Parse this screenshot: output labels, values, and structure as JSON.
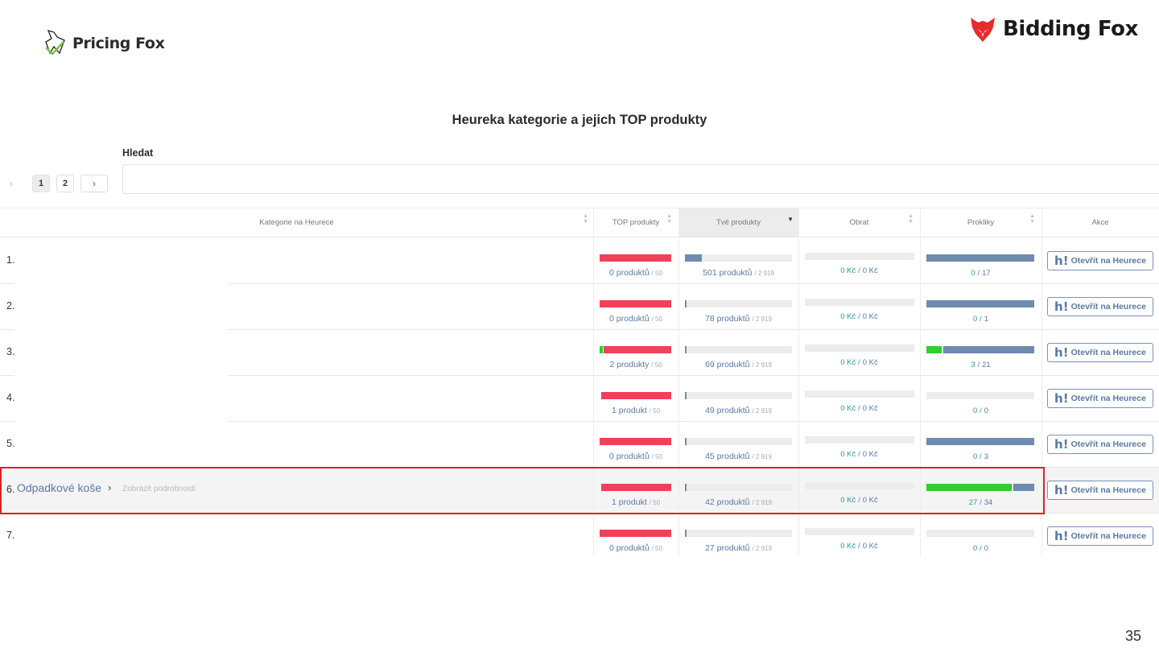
{
  "header": {
    "left_logo": "Pricing Fox",
    "right_logo": "Bidding Fox"
  },
  "title": "Heureka kategorie a jejich TOP produkty",
  "search": {
    "label": "Hledat",
    "placeholder": ""
  },
  "pagination": {
    "prev": "‹",
    "pages": [
      "1",
      "2"
    ],
    "active": "1",
    "next": "›"
  },
  "columns": {
    "category": "Kategorie na Heurece",
    "top": "TOP produkty",
    "yours": "Tvé produkty",
    "revenue": "Obrat",
    "clicks": "Prokliky",
    "action": "Akce"
  },
  "action_label": "Otevřít na Heurece",
  "action_icon": "h!",
  "rows": [
    {
      "rank": "1.",
      "name": "",
      "detail": "",
      "top_label": "0 produktů",
      "top_total": "/ 50",
      "top_fraction": 0,
      "your_label": "501 produktů",
      "your_total": "/ 2 919",
      "your_fraction": 0.16,
      "rev_a": "0 Kč",
      "rev_sep": "/",
      "rev_b": "0 Kč",
      "clicks_a": "0",
      "clicks_sep": "/",
      "clicks_b": "17",
      "clicks_fraction": 0
    },
    {
      "rank": "2.",
      "name": "",
      "detail": "",
      "top_label": "0 produktů",
      "top_total": "/ 50",
      "top_fraction": 0,
      "your_label": "78 produktů",
      "your_total": "/ 2 919",
      "your_fraction": 0.015,
      "rev_a": "0 Kč",
      "rev_sep": "/",
      "rev_b": "0 Kč",
      "clicks_a": "0",
      "clicks_sep": "/",
      "clicks_b": "1",
      "clicks_fraction": 0
    },
    {
      "rank": "3.",
      "name": "",
      "detail": "",
      "top_label": "2 produkty",
      "top_total": "/ 50",
      "top_fraction": 0.04,
      "your_label": "69 produktů",
      "your_total": "/ 2 919",
      "your_fraction": 0.012,
      "rev_a": "0 Kč",
      "rev_sep": "/",
      "rev_b": "0 Kč",
      "clicks_a": "3",
      "clicks_sep": "/",
      "clicks_b": "21",
      "clicks_fraction": 0.143
    },
    {
      "rank": "4.",
      "name": "",
      "detail": "",
      "top_label": "1 produkt",
      "top_total": "/ 50",
      "top_fraction": 0,
      "your_label": "49 produktů",
      "your_total": "/ 2 919",
      "your_fraction": 0.008,
      "rev_a": "0 Kč",
      "rev_sep": "/",
      "rev_b": "0 Kč",
      "clicks_a": "0",
      "clicks_sep": "/",
      "clicks_b": "0",
      "clicks_fraction": 0
    },
    {
      "rank": "5.",
      "name": "",
      "detail": "",
      "top_label": "0 produktů",
      "top_total": "/ 50",
      "top_fraction": 0,
      "your_label": "45 produktů",
      "your_total": "/ 2 919",
      "your_fraction": 0.007,
      "rev_a": "0 Kč",
      "rev_sep": "/",
      "rev_b": "0 Kč",
      "clicks_a": "0",
      "clicks_sep": "/",
      "clicks_b": "3",
      "clicks_fraction": 0
    },
    {
      "rank": "6.",
      "name": "Odpadkové koše",
      "detail": "Zobrazit podrobnosti",
      "top_label": "1 produkt",
      "top_total": "/ 50",
      "top_fraction": 0,
      "your_label": "42 produktů",
      "your_total": "/ 2 919",
      "your_fraction": 0.007,
      "rev_a": "0 Kč",
      "rev_sep": "/",
      "rev_b": "0 Kč",
      "clicks_a": "27",
      "clicks_sep": "/",
      "clicks_b": "34",
      "clicks_fraction": 0.794
    },
    {
      "rank": "7.",
      "name": "",
      "detail": "",
      "top_label": "0 produktů",
      "top_total": "/ 50",
      "top_fraction": 0,
      "your_label": "27 produktů",
      "your_total": "/ 2 919",
      "your_fraction": 0.005,
      "rev_a": "0 Kč",
      "rev_sep": "/",
      "rev_b": "0 Kč",
      "clicks_a": "0",
      "clicks_sep": "/",
      "clicks_b": "0",
      "clicks_fraction": 0
    }
  ],
  "slide_number": "35",
  "colors": {
    "red": "#f0405a",
    "green": "#33cc33",
    "blue": "#6e8bb0",
    "grey": "#ececec",
    "link": "#5a79a4",
    "teal": "#2a9d8f",
    "highlight": "#e02020"
  }
}
